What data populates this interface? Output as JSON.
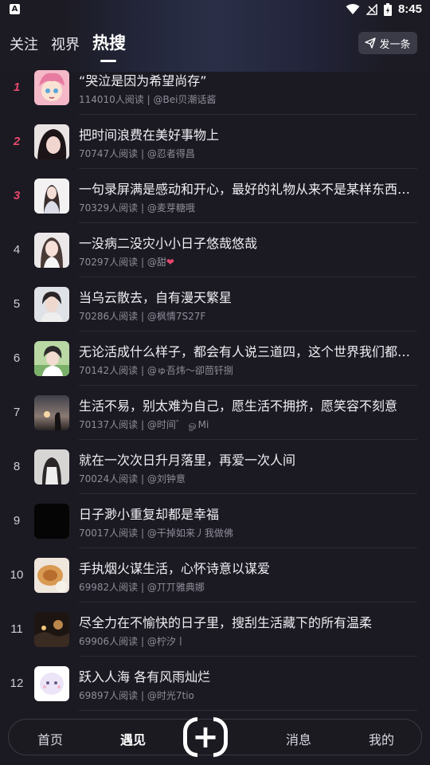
{
  "status_bar": {
    "app_icon": "A",
    "time": "8:45"
  },
  "tabs": [
    {
      "label": "关注"
    },
    {
      "label": "视界"
    },
    {
      "label": "热搜"
    }
  ],
  "post_button": {
    "label": "发一条",
    "icon": "send-icon"
  },
  "list": [
    {
      "rank": "1",
      "title": "“哭泣是因为希望尚存”",
      "reads": "114010人阅读",
      "author": "@Bei贝潮话酱"
    },
    {
      "rank": "2",
      "title": "把时间浪费在美好事物上",
      "reads": "70747人阅读",
      "author": "@忍者得昌"
    },
    {
      "rank": "3",
      "title": "一句录屏满是感动和开心，最好的礼物从来不是某样东西，…",
      "reads": "70329人阅读",
      "author": "@麦芽糖哦"
    },
    {
      "rank": "4",
      "title": "一没病二没灾小小日子悠哉悠哉",
      "reads": "70297人阅读",
      "author": "@甜",
      "heart": "❤"
    },
    {
      "rank": "5",
      "title": "当乌云散去，自有漫天繁星",
      "reads": "70286人阅读",
      "author": "@枫情7S27F"
    },
    {
      "rank": "6",
      "title": "无论活成什么样子，都会有人说三道四，这个世界我们都只…",
      "reads": "70142人阅读",
      "author": "@ゅ吾炜～卻茴钎捌"
    },
    {
      "rank": "7",
      "title": "生活不易，别太难为自己，愿生活不拥挤，愿笑容不刻意",
      "reads": "70137人阅读",
      "author": "@时间゛ ௐMi"
    },
    {
      "rank": "8",
      "title": "就在一次次日升月落里，再爱一次人间",
      "reads": "70024人阅读",
      "author": "@刘钟意"
    },
    {
      "rank": "9",
      "title": "日子渺小重复却都是幸福",
      "reads": "70017人阅读",
      "author": "@干掉如来丿我做佛"
    },
    {
      "rank": "10",
      "title": "手执烟火谋生活，心怀诗意以谋爱",
      "reads": "69982人阅读",
      "author": "@丌丌雅典娜"
    },
    {
      "rank": "11",
      "title": "尽全力在不愉快的日子里，搜刮生活藏下的所有温柔",
      "reads": "69906人阅读",
      "author": "@柠汐丨"
    },
    {
      "rank": "12",
      "title": "跃入人海 各有风雨灿烂",
      "reads": "69897人阅读",
      "author": "@时光7tio"
    }
  ],
  "bottom_nav": {
    "home": "首页",
    "meet": "遇见",
    "add": "+",
    "messages": "消息",
    "mine": "我的"
  },
  "colors": {
    "background": "#1b1a22",
    "accent": "#e8476d"
  }
}
